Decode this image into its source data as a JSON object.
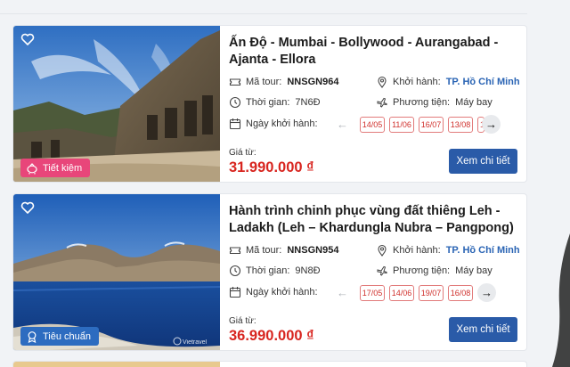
{
  "tours": [
    {
      "title": "Ấn Độ - Mumbai - Bollywood - Aurangabad - Ajanta - Ellora",
      "badge": "Tiết kiệm",
      "tour_code_label": "Mã tour:",
      "tour_code": "NNSGN964",
      "departure_label": "Khởi hành:",
      "departure": "TP. Hồ Chí Minh",
      "duration_label": "Thời gian:",
      "duration": "7N6Đ",
      "transport_label": "Phương tiện:",
      "transport": "Máy bay",
      "dates_label": "Ngày khởi hành:",
      "dates": [
        "14/05",
        "11/06",
        "16/07",
        "13/08",
        "1"
      ],
      "price_label": "Giá từ:",
      "price": "31.990.000 ₫",
      "detail_button": "Xem chi tiết",
      "icons": [
        "heart-icon",
        "piggy-bank-icon",
        "ticket-icon",
        "location-pin-icon",
        "clock-icon",
        "airplane-icon",
        "calendar-icon",
        "arrow-left-icon",
        "arrow-right-icon"
      ]
    },
    {
      "title": "Hành trình chinh phục vùng đất thiêng Leh - Ladakh (Leh – Khardungla Nubra – Pangpong)",
      "badge": "Tiêu chuẩn",
      "tour_code_label": "Mã tour:",
      "tour_code": "NNSGN954",
      "departure_label": "Khởi hành:",
      "departure": "TP. Hồ Chí Minh",
      "duration_label": "Thời gian:",
      "duration": "9N8Đ",
      "transport_label": "Phương tiện:",
      "transport": "Máy bay",
      "dates_label": "Ngày khởi hành:",
      "dates": [
        "17/05",
        "14/06",
        "19/07",
        "16/08"
      ],
      "price_label": "Giá từ:",
      "price": "36.990.000 ₫",
      "detail_button": "Xem chi tiết",
      "watermark": "Vietravel",
      "icons": [
        "heart-icon",
        "standard-badge-icon",
        "ticket-icon",
        "location-pin-icon",
        "clock-icon",
        "airplane-icon",
        "calendar-icon",
        "arrow-left-icon",
        "arrow-right-icon"
      ]
    }
  ],
  "colors": {
    "price": "#d8251f",
    "button": "#2a5ba8",
    "link": "#2a64b4",
    "badge_savings": "#e8467a",
    "badge_standard": "#2d6cc0",
    "date_chip": "#d0312d"
  }
}
